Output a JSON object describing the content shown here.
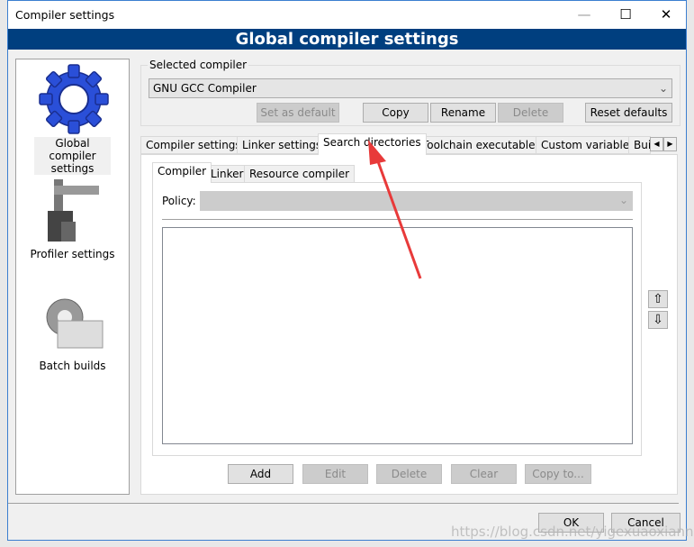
{
  "window": {
    "title": "Compiler settings",
    "minimize": "—",
    "maximize": "☐",
    "close": "✕"
  },
  "banner": "Global compiler settings",
  "sidebar": {
    "items": [
      {
        "label": "Global compiler settings",
        "icon": "gear-icon"
      },
      {
        "label": "Profiler settings",
        "icon": "caliper-icon"
      },
      {
        "label": "Batch builds",
        "icon": "gear-stack-icon"
      }
    ]
  },
  "selected_compiler": {
    "label": "Selected compiler",
    "value": "GNU GCC Compiler",
    "buttons": {
      "set_default": "Set as default",
      "copy": "Copy",
      "rename": "Rename",
      "delete": "Delete",
      "reset": "Reset defaults"
    }
  },
  "tabs": [
    "Compiler settings",
    "Linker settings",
    "Search directories",
    "Toolchain executables",
    "Custom variables",
    "Bui"
  ],
  "inner_tabs": [
    "Compiler",
    "Linker",
    "Resource compiler"
  ],
  "policy": {
    "label": "Policy:",
    "value": ""
  },
  "list_buttons": {
    "add": "Add",
    "edit": "Edit",
    "delete": "Delete",
    "clear": "Clear",
    "copy_to": "Copy to..."
  },
  "move": {
    "up": "⇧",
    "down": "⇩"
  },
  "footer": {
    "ok": "OK",
    "cancel": "Cancel"
  },
  "watermark": "https://blog.csdn.net/yigexuaoxianny",
  "colors": {
    "banner": "#003f7f",
    "arrow": "#e83a3a"
  }
}
